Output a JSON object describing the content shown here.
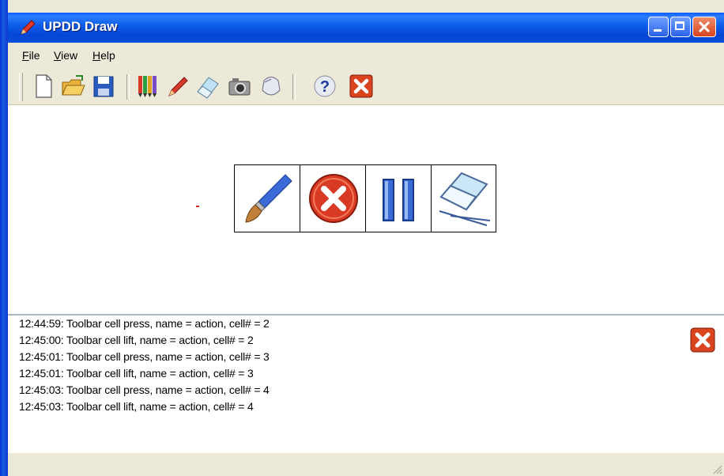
{
  "window": {
    "title": "UPDD Draw"
  },
  "menu": {
    "items": [
      {
        "label": "File",
        "accel": "F",
        "rest": "ile"
      },
      {
        "label": "View",
        "accel": "V",
        "rest": "iew"
      },
      {
        "label": "Help",
        "accel": "H",
        "rest": "elp"
      }
    ]
  },
  "toolbar": {
    "icons": [
      "new-document-icon",
      "open-folder-icon",
      "save-icon",
      "pen-colors-icon",
      "pen-icon",
      "eraser-icon",
      "camera-icon",
      "mouse-icon",
      "help-icon",
      "close-icon"
    ]
  },
  "onscreen_toolbar": {
    "name": "action",
    "cells": [
      "paintbrush-icon",
      "cancel-icon",
      "pause-icon",
      "eraser-icon"
    ]
  },
  "log": {
    "lines": [
      "12:44:59: Toolbar cell press, name = action, cell# = 2",
      "12:45:00: Toolbar cell lift, name = action, cell# = 2",
      "12:45:01: Toolbar cell press, name = action, cell# = 3",
      "12:45:01: Toolbar cell lift, name = action, cell# = 3",
      "12:45:03: Toolbar cell press, name = action, cell# = 4",
      "12:45:03: Toolbar cell lift, name = action, cell# = 4"
    ]
  },
  "colors": {
    "titlebar": "#0a5ae8",
    "close_red": "#d9431e",
    "accent_blue": "#2b62e6"
  }
}
